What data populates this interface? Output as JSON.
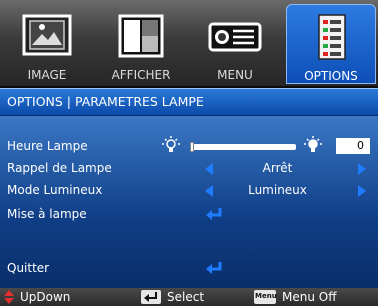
{
  "tabs": [
    {
      "label": "IMAGE",
      "icon": "image-icon"
    },
    {
      "label": "AFFICHER",
      "icon": "display-icon"
    },
    {
      "label": "MENU",
      "icon": "projector-icon"
    },
    {
      "label": "OPTIONS",
      "icon": "options-icon",
      "active": true
    }
  ],
  "title": "OPTIONS | PARAMETRES LAMPE",
  "rows": [
    {
      "label": "Heure Lampe",
      "value": "0"
    },
    {
      "label": "Rappel de Lampe",
      "value": "Arrêt"
    },
    {
      "label": "Mode Lumineux",
      "value": "Lumineux"
    },
    {
      "label": "Mise à  lampe"
    },
    {
      "label": "Quitter"
    }
  ],
  "footer": {
    "updown": "UpDown",
    "select": "Select",
    "menu_key": "Menu",
    "menuoff": "Menu Off"
  },
  "colors": {
    "accent": "#1f7bff",
    "title_bar": "#1a63c4"
  }
}
